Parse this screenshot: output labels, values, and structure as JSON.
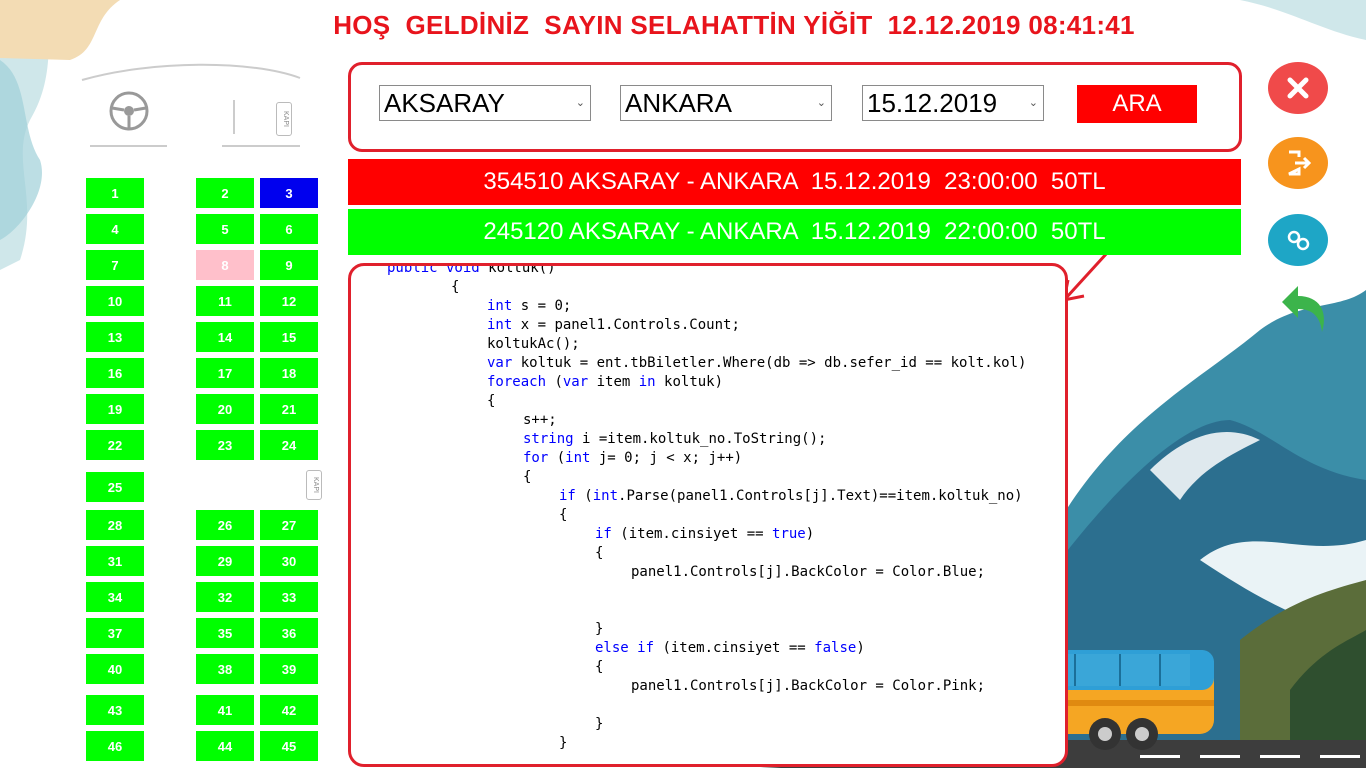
{
  "header": {
    "title_parts": [
      "HOŞ",
      "GELDİNİZ",
      "SAYIN",
      "SELAHATTİN",
      "YİĞİT"
    ],
    "datetime": "12.12.2019 08:41:41"
  },
  "search": {
    "from": "AKSARAY",
    "to": "ANKARA",
    "date": "15.12.2019",
    "button_label": "ARA"
  },
  "trips": [
    {
      "text": "354510 AKSARAY - ANKARA  15.12.2019  23:00:00  50TL",
      "color": "#ff0000"
    },
    {
      "text": "245120 AKSARAY - ANKARA  15.12.2019  22:00:00  50TL",
      "color": "#00ff00"
    }
  ],
  "seat_panel": {
    "door_label": "KAPI",
    "seats": [
      {
        "no": "1",
        "state": "empty"
      },
      {
        "no": "2",
        "state": "empty"
      },
      {
        "no": "3",
        "state": "male"
      },
      {
        "no": "4",
        "state": "empty"
      },
      {
        "no": "5",
        "state": "empty"
      },
      {
        "no": "6",
        "state": "empty"
      },
      {
        "no": "7",
        "state": "empty"
      },
      {
        "no": "8",
        "state": "female"
      },
      {
        "no": "9",
        "state": "empty"
      },
      {
        "no": "10",
        "state": "empty"
      },
      {
        "no": "11",
        "state": "empty"
      },
      {
        "no": "12",
        "state": "empty"
      },
      {
        "no": "13",
        "state": "empty"
      },
      {
        "no": "14",
        "state": "empty"
      },
      {
        "no": "15",
        "state": "empty"
      },
      {
        "no": "16",
        "state": "empty"
      },
      {
        "no": "17",
        "state": "empty"
      },
      {
        "no": "18",
        "state": "empty"
      },
      {
        "no": "19",
        "state": "empty"
      },
      {
        "no": "20",
        "state": "empty"
      },
      {
        "no": "21",
        "state": "empty"
      },
      {
        "no": "22",
        "state": "empty"
      },
      {
        "no": "23",
        "state": "empty"
      },
      {
        "no": "24",
        "state": "empty"
      },
      {
        "no": "25",
        "state": "empty"
      },
      {
        "no": "28",
        "state": "empty"
      },
      {
        "no": "26",
        "state": "empty"
      },
      {
        "no": "27",
        "state": "empty"
      },
      {
        "no": "31",
        "state": "empty"
      },
      {
        "no": "29",
        "state": "empty"
      },
      {
        "no": "30",
        "state": "empty"
      },
      {
        "no": "34",
        "state": "empty"
      },
      {
        "no": "32",
        "state": "empty"
      },
      {
        "no": "33",
        "state": "empty"
      },
      {
        "no": "37",
        "state": "empty"
      },
      {
        "no": "35",
        "state": "empty"
      },
      {
        "no": "36",
        "state": "empty"
      },
      {
        "no": "40",
        "state": "empty"
      },
      {
        "no": "38",
        "state": "empty"
      },
      {
        "no": "39",
        "state": "empty"
      },
      {
        "no": "43",
        "state": "empty"
      },
      {
        "no": "41",
        "state": "empty"
      },
      {
        "no": "42",
        "state": "empty"
      },
      {
        "no": "46",
        "state": "empty"
      },
      {
        "no": "44",
        "state": "empty"
      },
      {
        "no": "45",
        "state": "empty"
      }
    ]
  },
  "colors": {
    "empty": "#00ff00",
    "male": "#0000ee",
    "female": "#ffc0cb",
    "accent_red": "#ff0000"
  },
  "code_lines": [
    {
      "indent": 1,
      "tokens": [
        [
          "kw",
          "public void"
        ],
        [
          "t",
          " koltuk()"
        ]
      ]
    },
    {
      "indent": 2,
      "tokens": [
        [
          "t",
          "{"
        ]
      ]
    },
    {
      "indent": 3,
      "tokens": [
        [
          "kw",
          "int"
        ],
        [
          "t",
          " s = 0;"
        ]
      ]
    },
    {
      "indent": 3,
      "tokens": [
        [
          "kw",
          "int"
        ],
        [
          "t",
          " x = panel1.Controls.Count;"
        ]
      ]
    },
    {
      "indent": 3,
      "tokens": [
        [
          "t",
          "koltukAc();"
        ]
      ]
    },
    {
      "indent": 3,
      "tokens": [
        [
          "kw",
          "var"
        ],
        [
          "t",
          " koltuk = ent.tbBiletler.Where(db => db.sefer_id == kolt.kol)"
        ]
      ]
    },
    {
      "indent": 3,
      "tokens": [
        [
          "kw",
          "foreach"
        ],
        [
          "t",
          " ("
        ],
        [
          "kw",
          "var"
        ],
        [
          "t",
          " item "
        ],
        [
          "kw",
          "in"
        ],
        [
          "t",
          " koltuk)"
        ]
      ]
    },
    {
      "indent": 3,
      "tokens": [
        [
          "t",
          "{"
        ]
      ]
    },
    {
      "indent": 4,
      "tokens": [
        [
          "t",
          "s++;"
        ]
      ]
    },
    {
      "indent": 4,
      "tokens": [
        [
          "kw",
          "string"
        ],
        [
          "t",
          " i =item.koltuk_no.ToString();"
        ]
      ]
    },
    {
      "indent": 4,
      "tokens": [
        [
          "kw",
          "for"
        ],
        [
          "t",
          " ("
        ],
        [
          "kw",
          "int"
        ],
        [
          "t",
          " j= 0; j < x; j++)"
        ]
      ]
    },
    {
      "indent": 4,
      "tokens": [
        [
          "t",
          "{"
        ]
      ]
    },
    {
      "indent": 5,
      "tokens": [
        [
          "kw",
          "if"
        ],
        [
          "t",
          " ("
        ],
        [
          "kw",
          "int"
        ],
        [
          "t",
          ".Parse(panel1.Controls[j].Text)==item.koltuk_no)"
        ]
      ]
    },
    {
      "indent": 5,
      "tokens": [
        [
          "t",
          "{"
        ]
      ]
    },
    {
      "indent": 6,
      "tokens": [
        [
          "kw",
          "if"
        ],
        [
          "t",
          " (item.cinsiyet == "
        ],
        [
          "kw",
          "true"
        ],
        [
          "t",
          ")"
        ]
      ]
    },
    {
      "indent": 6,
      "tokens": [
        [
          "t",
          "{"
        ]
      ]
    },
    {
      "indent": 7,
      "tokens": [
        [
          "t",
          "panel1.Controls[j].BackColor = Color.Blue;"
        ]
      ]
    },
    {
      "indent": 7,
      "tokens": []
    },
    {
      "indent": 7,
      "tokens": []
    },
    {
      "indent": 6,
      "tokens": [
        [
          "t",
          "}"
        ]
      ]
    },
    {
      "indent": 6,
      "tokens": [
        [
          "kw",
          "else if"
        ],
        [
          "t",
          " (item.cinsiyet == "
        ],
        [
          "kw",
          "false"
        ],
        [
          "t",
          ")"
        ]
      ]
    },
    {
      "indent": 6,
      "tokens": [
        [
          "t",
          "{"
        ]
      ]
    },
    {
      "indent": 7,
      "tokens": [
        [
          "t",
          "panel1.Controls[j].BackColor = Color.Pink;"
        ]
      ]
    },
    {
      "indent": 7,
      "tokens": []
    },
    {
      "indent": 6,
      "tokens": [
        [
          "t",
          "}"
        ]
      ]
    },
    {
      "indent": 5,
      "tokens": [
        [
          "t",
          "}"
        ]
      ]
    }
  ],
  "right_buttons": [
    {
      "name": "close-icon",
      "color": "#f04a4a"
    },
    {
      "name": "logout-icon",
      "color": "#f7941d"
    },
    {
      "name": "settings-icon",
      "color": "#1ea6c6"
    },
    {
      "name": "back-icon",
      "color": "#3cb44b"
    }
  ]
}
